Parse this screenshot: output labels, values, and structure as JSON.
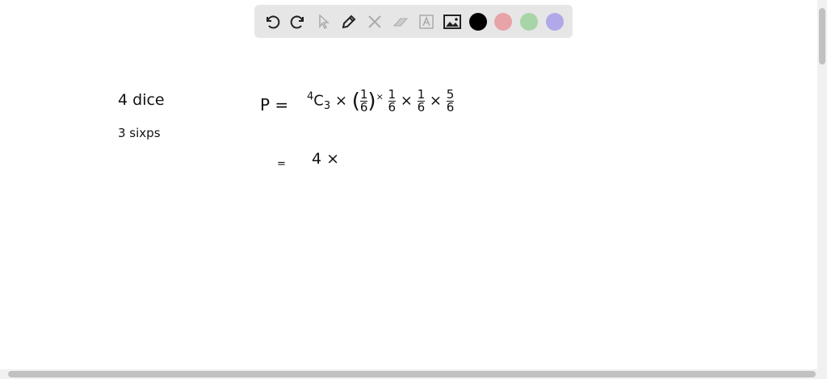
{
  "toolbar": {
    "tools": [
      "undo-icon",
      "redo-icon",
      "select-icon",
      "pen-icon",
      "tools-icon",
      "eraser-icon",
      "text-icon",
      "image-icon"
    ],
    "colors": [
      "#000000",
      "#e8a3a8",
      "#a8d5a8",
      "#b0a8e8"
    ]
  },
  "notes": {
    "line1": "4 dice",
    "line2": "3  sixps",
    "p_label": "P =",
    "comb_sup": "4",
    "comb_c": "C",
    "comb_sub": "3",
    "times": "×",
    "one": "1",
    "six": "6",
    "five": "5",
    "eq2": "=",
    "line3": "4 ×"
  }
}
